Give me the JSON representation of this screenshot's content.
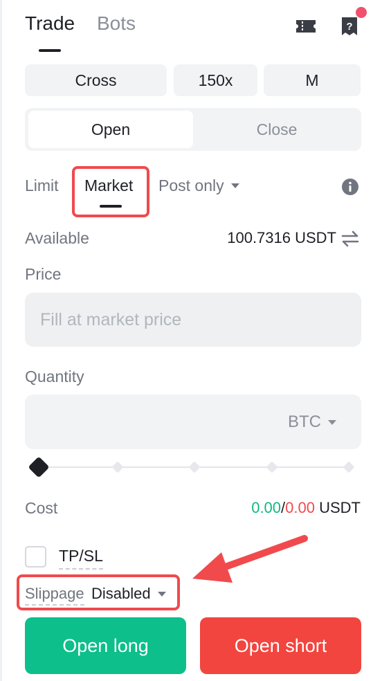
{
  "header": {
    "tabs": [
      {
        "label": "Trade",
        "active": true
      },
      {
        "label": "Bots",
        "active": false
      }
    ],
    "icons": [
      "ticket-icon",
      "help-icon"
    ],
    "notification_dot_color": "#f0506e"
  },
  "margin": {
    "mode": "Cross",
    "leverage": "150x",
    "asset_mode": "M"
  },
  "position_action": {
    "open_label": "Open",
    "close_label": "Close",
    "selected": "Open"
  },
  "order_types": {
    "limit": "Limit",
    "market": "Market",
    "post_only": "Post only",
    "selected": "Market"
  },
  "available": {
    "label": "Available",
    "value": "100.7316 USDT"
  },
  "price": {
    "label": "Price",
    "placeholder": "Fill at market price"
  },
  "quantity": {
    "label": "Quantity",
    "value": "",
    "unit": "BTC",
    "slider_percent": 0
  },
  "cost": {
    "label": "Cost",
    "long": "0.00",
    "separator": "/",
    "short": "0.00",
    "unit": "USDT"
  },
  "tpsl": {
    "label": "TP/SL",
    "checked": false
  },
  "slippage": {
    "label": "Slippage",
    "value": "Disabled"
  },
  "actions": {
    "open_long": "Open long",
    "open_short": "Open short"
  },
  "colors": {
    "long": "#0dbf8a",
    "short": "#f2453f",
    "highlight": "#f04a4d"
  }
}
